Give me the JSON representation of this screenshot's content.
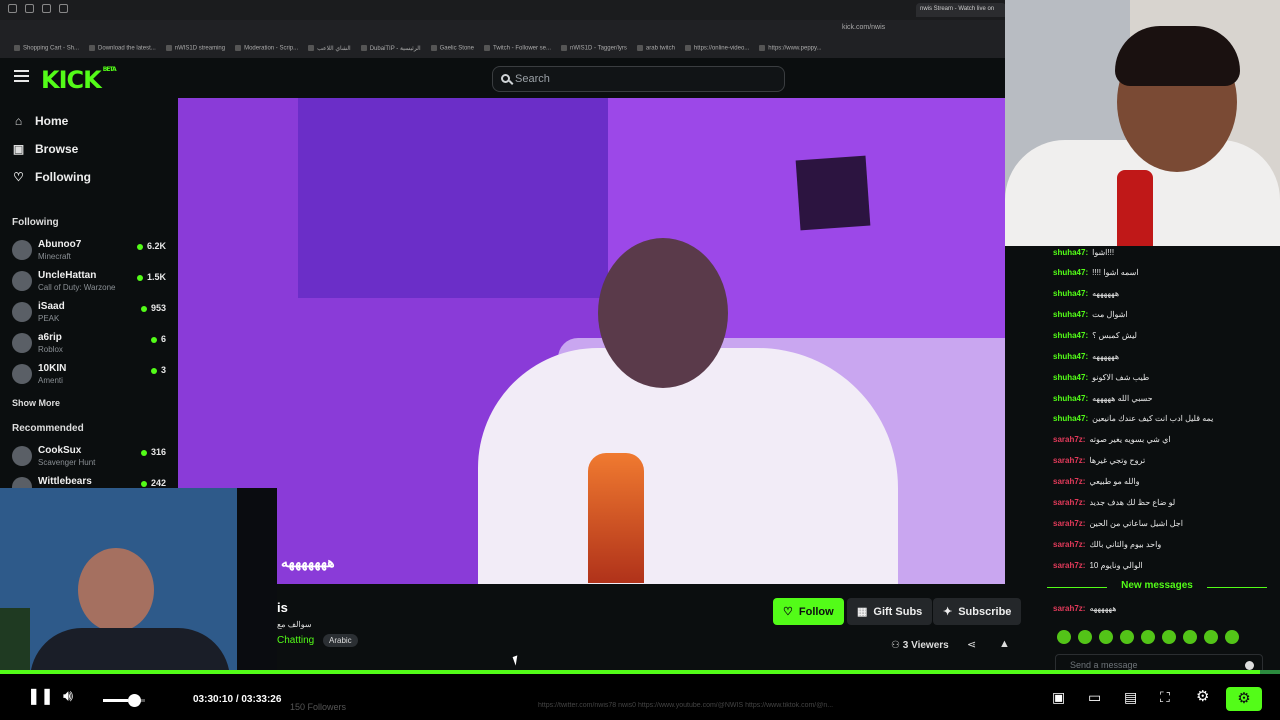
{
  "browser": {
    "active_tab": "nwis Stream - Watch live on",
    "url": "kick.com/nwis",
    "bookmarks": [
      "Shopping Cart - Sh...",
      "Download the latest...",
      "nWIS1D streaming",
      "Moderation - Scrip...",
      "الشاي اللاعب",
      "DubaiTIP - الرئيسية",
      "Gaelic Stone",
      "Twitch - Follower se...",
      "nWIS1D - Tagger/lyrs",
      "arab twitch",
      "https://online-video...",
      "https://www.peppy..."
    ]
  },
  "header": {
    "logo": "KICK",
    "logo_badge": "BETA",
    "search_placeholder": "Search"
  },
  "sidebar": {
    "nav": [
      {
        "label": "Home",
        "icon": "home-icon"
      },
      {
        "label": "Browse",
        "icon": "browse-icon"
      },
      {
        "label": "Following",
        "icon": "heart-icon"
      }
    ],
    "following_title": "Following",
    "following": [
      {
        "name": "Abunoo7",
        "game": "Minecraft",
        "viewers": "6.2K"
      },
      {
        "name": "UncleHattan",
        "game": "Call of Duty: Warzone",
        "viewers": "1.5K"
      },
      {
        "name": "iSaad",
        "game": "PEAK",
        "viewers": "953"
      },
      {
        "name": "a6rip",
        "game": "Roblox",
        "viewers": "6"
      },
      {
        "name": "10KIN",
        "game": "Amenti",
        "viewers": "3"
      }
    ],
    "show_more": "Show More",
    "recommended_title": "Recommended",
    "recommended": [
      {
        "name": "CookSux",
        "game": "Scavenger Hunt",
        "viewers": "316"
      },
      {
        "name": "Wittlebears",
        "game": "",
        "viewers": "242"
      }
    ]
  },
  "video": {
    "overlay_text": "هههههههه"
  },
  "stream_info": {
    "name": "is",
    "title": "سوالف مع",
    "category": "Chatting",
    "tag": "Arabic",
    "viewers": "3 Viewers",
    "follow_label": "Follow",
    "gift_label": "Gift Subs",
    "subscribe_label": "Subscribe"
  },
  "chat": {
    "messages": [
      {
        "user": "shuha47:",
        "text": "اشوا!!!",
        "color": "green"
      },
      {
        "user": "shuha47:",
        "text": "!!!! اسمه اشوا",
        "color": "green"
      },
      {
        "user": "shuha47:",
        "text": "ههههههه",
        "color": "green"
      },
      {
        "user": "shuha47:",
        "text": "اشوال مت",
        "color": "green"
      },
      {
        "user": "shuha47:",
        "text": "ليش كمبس ؟",
        "color": "green"
      },
      {
        "user": "shuha47:",
        "text": "ههههههه",
        "color": "green"
      },
      {
        "user": "shuha47:",
        "text": "طيب شف الاكونو",
        "color": "green"
      },
      {
        "user": "shuha47:",
        "text": "حسبي الله هههههه",
        "color": "green"
      },
      {
        "user": "shuha47:",
        "text": "يمه قليل ادب انت كيف عندك مانيعين",
        "color": "green"
      },
      {
        "user": "sarah7z:",
        "text": "اي شي بسويه يغير صوته",
        "color": "red"
      },
      {
        "user": "sarah7z:",
        "text": "تروح وتجي غيرها",
        "color": "red"
      },
      {
        "user": "sarah7z:",
        "text": "والله مو طبيعي",
        "color": "red"
      },
      {
        "user": "sarah7z:",
        "text": "لو ضاع حظ لك هدف جديد",
        "color": "red"
      },
      {
        "user": "sarah7z:",
        "text": "اجل اشيل ساعاتي من الحين",
        "color": "red"
      },
      {
        "user": "sarah7z:",
        "text": "واحد بيوم والثاني بالك",
        "color": "red"
      },
      {
        "user": "sarah7z:",
        "text": "الوالي ونايوم 10",
        "color": "red"
      }
    ],
    "new_messages": "New messages",
    "last_message": {
      "user": "sarah7z:",
      "text": "ههههههه",
      "color": "red"
    },
    "input_placeholder": "Send a message"
  },
  "player": {
    "current_time": "03:30:10",
    "separator": "/",
    "duration": "03:33:26",
    "progress": 0.984,
    "volume": 0.6,
    "followers": "150 Followers",
    "links": "https://twitter.com/nwis78   nwis0   https://www.youtube.com/@NWIS   https://www.tiktok.com/@n..."
  },
  "colors": {
    "accent": "#53fc18",
    "background": "#0b0e0f",
    "chat_red": "#e23a5a"
  }
}
